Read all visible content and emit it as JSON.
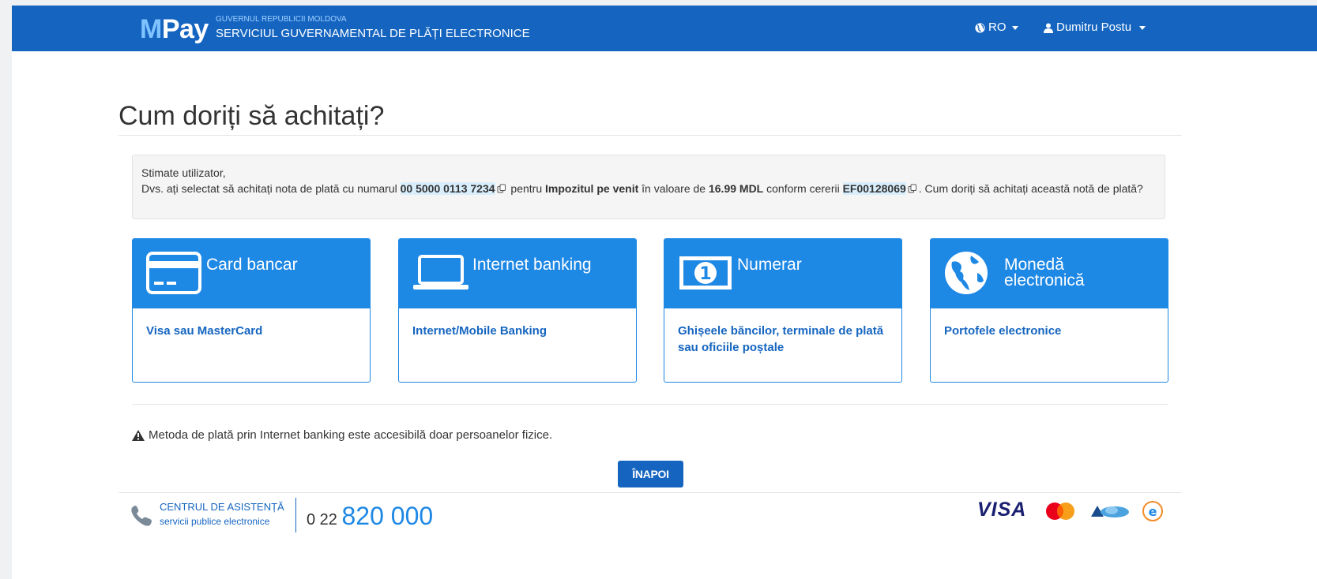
{
  "nav": {
    "brand": "MPay",
    "brand_first": "M",
    "brand_rest": "Pay",
    "gov_small": "GUVERNUL REPUBLICII MOLDOVA",
    "gov_big": "SERVICIUL GUVERNAMENTAL DE PLĂȚI ELECTRONICE",
    "language": "RO",
    "user": "Dumitru Postu"
  },
  "page_title": "Cum doriți să achitați?",
  "notice": {
    "greeting": "Stimate utilizator,",
    "text1": "Dvs. ați selectat să achitați nota de plată cu numarul ",
    "invoice_number": "00 5000 0113 7234",
    "text2": " pentru ",
    "tax_name": "Impozitul pe venit",
    "text3": " în valoare de ",
    "amount": "16.99 MDL",
    "text4": " conform cererii ",
    "request_id": "EF00128069",
    "text5": ". Cum doriți să achitați această notă de plată?"
  },
  "payment_methods": [
    {
      "title": "Card bancar",
      "description": "Visa sau MasterCard",
      "icon": "credit-card-icon"
    },
    {
      "title": "Internet banking",
      "description": "Internet/Mobile Banking",
      "icon": "laptop-icon"
    },
    {
      "title": "Numerar",
      "description": "Ghișeele băncilor, terminale de plată sau oficiile poștale",
      "icon": "banknote-icon"
    },
    {
      "title_line1": "Monedă",
      "title_line2": "electronică",
      "description": "Portofele electronice",
      "icon": "globe-icon"
    }
  ],
  "warning": "Metoda de plată prin Internet banking este accesibilă doar persoanelor fizice.",
  "back_button": "ÎNAPOI",
  "footer": {
    "support_title": "CENTRUL DE ASISTENȚĂ",
    "support_subtitle": "servicii publice electronice",
    "phone_prefix": "0 22",
    "phone_main": "820 000",
    "payment_logos": [
      "VISA",
      "MasterCard",
      "Cloud",
      "e"
    ]
  },
  "colors": {
    "nav_bg": "#1565c0",
    "card_head": "#1e88e5",
    "link": "#1565c0"
  }
}
